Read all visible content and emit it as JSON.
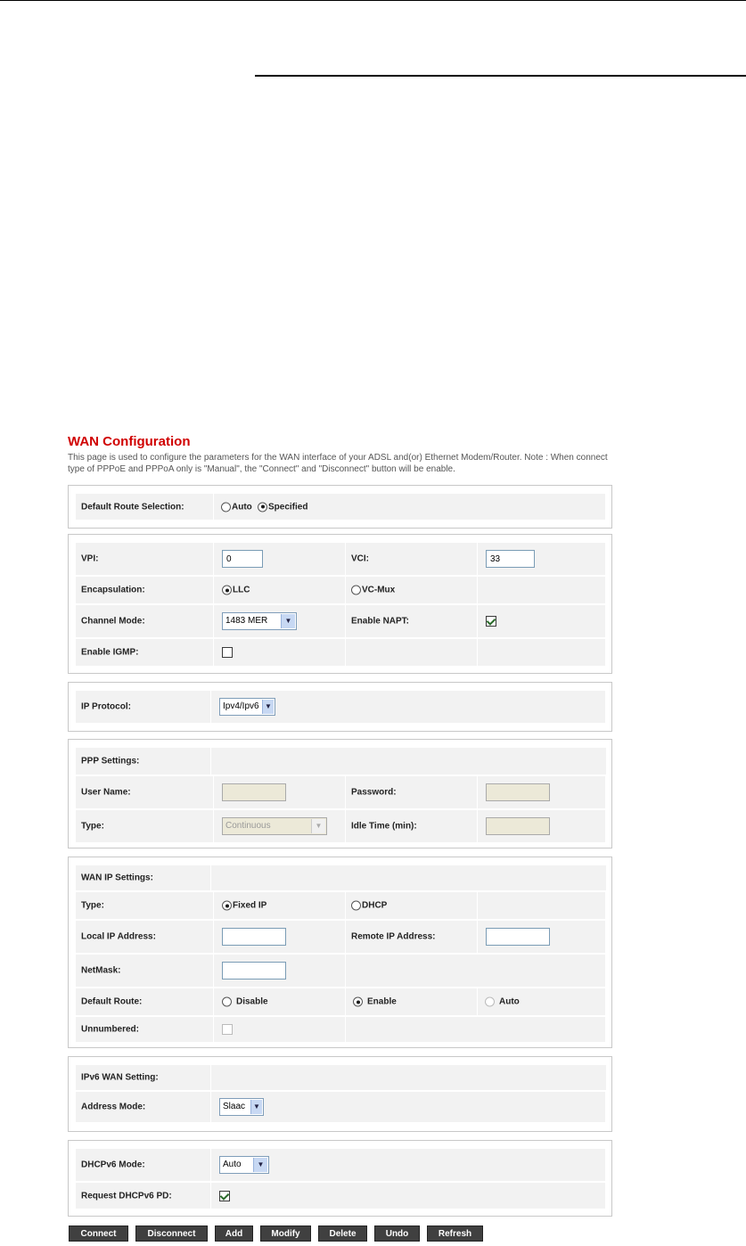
{
  "page": {
    "title": "WAN Configuration",
    "description": "This page is used to configure the parameters for the WAN interface of your ADSL and(or) Ethernet Modem/Router. Note : When connect type of PPPoE and PPPoA only is \"Manual\", the \"Connect\" and \"Disconnect\" button will be enable."
  },
  "default_route": {
    "label": "Default Route Selection:",
    "auto": "Auto",
    "specified": "Specified"
  },
  "atm": {
    "vpi_label": "VPI:",
    "vpi_value": "0",
    "vci_label": "VCI:",
    "vci_value": "33",
    "encap_label": "Encapsulation:",
    "llc": "LLC",
    "vcmux": "VC-Mux",
    "channel_label": "Channel Mode:",
    "channel_value": "1483 MER",
    "napt_label": "Enable NAPT:",
    "igmp_label": "Enable IGMP:"
  },
  "ip_protocol": {
    "label": "IP Protocol:",
    "value": "Ipv4/Ipv6"
  },
  "ppp": {
    "header": "PPP Settings:",
    "user_label": "User Name:",
    "password_label": "Password:",
    "type_label": "Type:",
    "type_value": "Continuous",
    "idle_label": "Idle Time (min):"
  },
  "wan_ip": {
    "header": "WAN IP Settings:",
    "type_label": "Type:",
    "fixed": "Fixed IP",
    "dhcp": "DHCP",
    "local_label": "Local IP Address:",
    "remote_label": "Remote IP Address:",
    "netmask_label": "NetMask:",
    "default_route_label": "Default Route:",
    "disable": "Disable",
    "enable": "Enable",
    "auto": "Auto",
    "unnumbered_label": "Unnumbered:"
  },
  "ipv6": {
    "header": "IPv6 WAN Setting:",
    "address_mode_label": "Address Mode:",
    "address_mode_value": "Slaac",
    "dhcpv6_label": "DHCPv6 Mode:",
    "dhcpv6_value": "Auto",
    "request_pd_label": "Request DHCPv6 PD:"
  },
  "buttons": {
    "connect": "Connect",
    "disconnect": "Disconnect",
    "add": "Add",
    "modify": "Modify",
    "delete": "Delete",
    "undo": "Undo",
    "refresh": "Refresh"
  },
  "icons": {
    "dropdown": "chevron-down-icon",
    "checkbox_checked": "checkmark-icon"
  }
}
